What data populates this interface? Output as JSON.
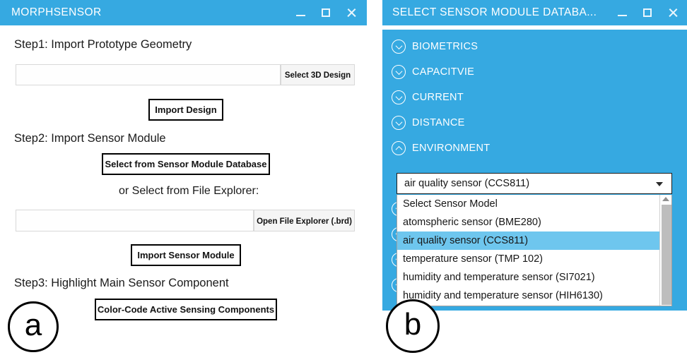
{
  "theme": {
    "accent": "#36a9e1",
    "highlight": "#6ec6ee",
    "title_text": "#ffffff",
    "scrollbar_thumb": "#bdbdbd"
  },
  "panel_a": {
    "title": "MORPHSENSOR",
    "controls": {
      "minimize": "minimize-icon",
      "maximize": "maximize-icon",
      "close": "close-icon"
    },
    "step1": {
      "label": "Step1: Import Prototype Geometry",
      "input_value": "",
      "input_placeholder": "",
      "browse_button": "Select 3D Design",
      "action_button": "Import Design"
    },
    "step2": {
      "label": "Step2: Import Sensor Module",
      "database_button": "Select from Sensor Module Database",
      "or_note": "or Select from File Explorer:",
      "input_value": "",
      "input_placeholder": "",
      "browse_button": "Open File Explorer (.brd)",
      "action_button": "Import Sensor Module"
    },
    "step3": {
      "label": "Step3: Highlight Main Sensor Component",
      "action_button": "Color-Code Active Sensing Components"
    },
    "figure_letter": "a"
  },
  "panel_b": {
    "title": "SELECT SENSOR MODULE DATABA...",
    "controls": {
      "minimize": "minimize-icon",
      "maximize": "maximize-icon",
      "close": "close-icon"
    },
    "categories": [
      {
        "label": "BIOMETRICS",
        "expanded": false,
        "icon": "chevron-down-icon"
      },
      {
        "label": "CAPACITVIE",
        "expanded": false,
        "icon": "chevron-down-icon"
      },
      {
        "label": "CURRENT",
        "expanded": false,
        "icon": "chevron-down-icon"
      },
      {
        "label": "DISTANCE",
        "expanded": false,
        "icon": "chevron-down-icon"
      },
      {
        "label": "ENVIRONMENT",
        "expanded": true,
        "icon": "chevron-up-icon"
      }
    ],
    "hidden_categories_count": 4,
    "combo": {
      "selected_value": "air quality sensor (CCS811)",
      "caret": "caret-down-icon",
      "open": true
    },
    "dropdown_options": [
      {
        "label": "Select Sensor Model",
        "selected": false
      },
      {
        "label": "atomspheric sensor (BME280)",
        "selected": false
      },
      {
        "label": "air quality sensor (CCS811)",
        "selected": true
      },
      {
        "label": "temperature sensor (TMP 102)",
        "selected": false
      },
      {
        "label": "humidity and temperature sensor (SI7021)",
        "selected": false
      },
      {
        "label": "humidity and temperature sensor (HIH6130)",
        "selected": false
      }
    ],
    "scrollbar": {
      "up_arrow": "scroll-up-arrow-icon"
    },
    "figure_letter": "b"
  }
}
